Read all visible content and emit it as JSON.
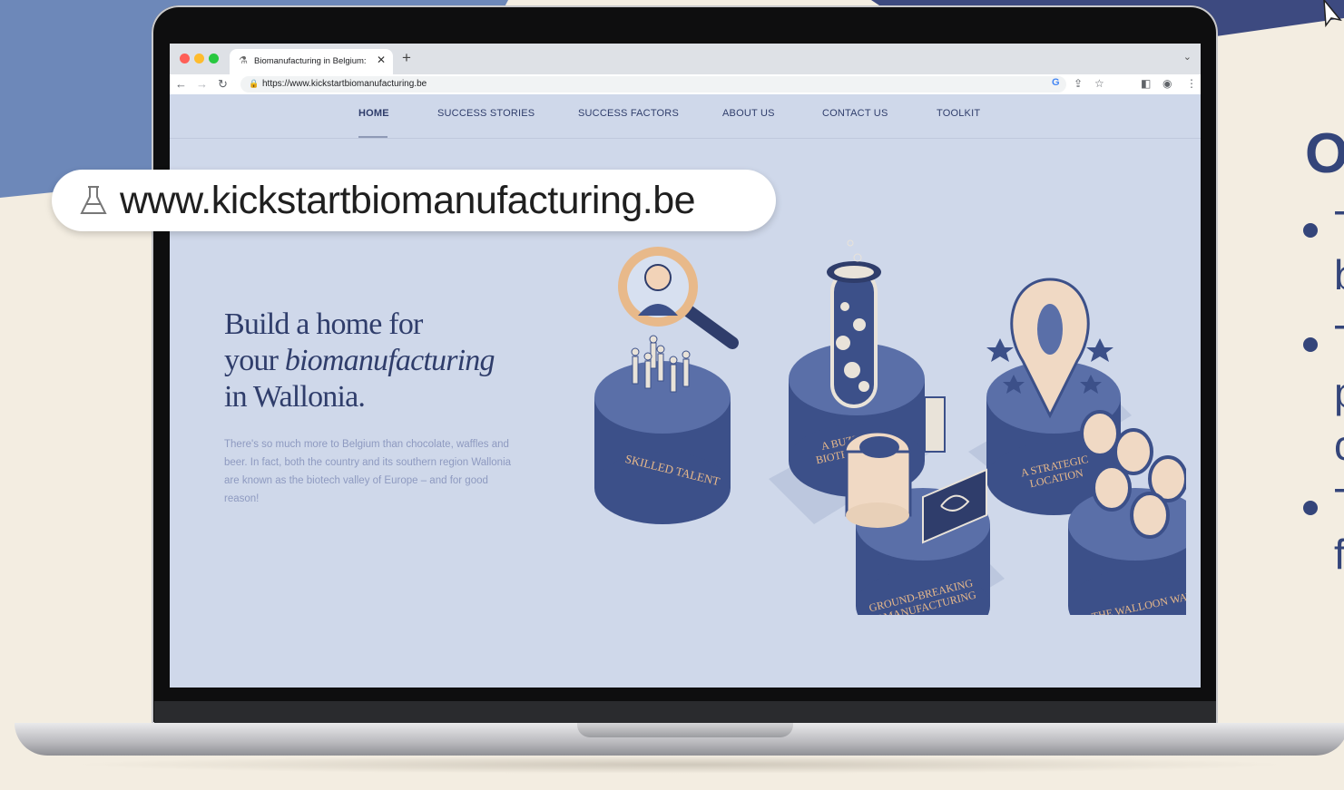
{
  "browser": {
    "tab_title": "Biomanufacturing in Belgium: ...",
    "url": "https://www.kickstartbiomanufacturing.be"
  },
  "site": {
    "nav": [
      "HOME",
      "SUCCESS STORIES",
      "SUCCESS FACTORS",
      "ABOUT US",
      "CONTACT US",
      "TOOLKIT"
    ],
    "active_nav": "HOME",
    "hero": {
      "title_line1": "Build a home for",
      "title_line2_plain": "your ",
      "title_line2_italic": "biomanufacturing",
      "title_line3": "in Wallonia.",
      "body": "There's so much more to Belgium than chocolate, waffles and beer. In fact, both the country and its southern region Wallonia are known as the biotech valley of Europe – and for good reason!"
    },
    "illustration_labels": {
      "skilled_talent": "SKILLED TALENT",
      "biotech_scene_1": "A BUZZING",
      "biotech_scene_2": "BIOTECH SCENE",
      "strategic_location_1": "A STRATEGIC",
      "strategic_location_2": "LOCATION",
      "biomanufacturing_1": "GROUND-BREAKING",
      "biomanufacturing_2": "BIOMANUFACTURING",
      "walloon_way": "THE WALLOON WAY"
    }
  },
  "callout": {
    "url_text": "www.kickstartbiomanufacturing.be"
  },
  "right_panel": {
    "heading_fragment": "O",
    "bullet_fragments": [
      "T",
      "b",
      "T",
      "p",
      "c",
      "T",
      "f"
    ]
  },
  "colors": {
    "page_background": "#f3ede1",
    "hero_background": "#cfd8ea",
    "navy": "#2f3d6b",
    "pedestal": "#3c5089",
    "label_gold": "#e8b98a",
    "bg_blue": "#6d88b9"
  }
}
